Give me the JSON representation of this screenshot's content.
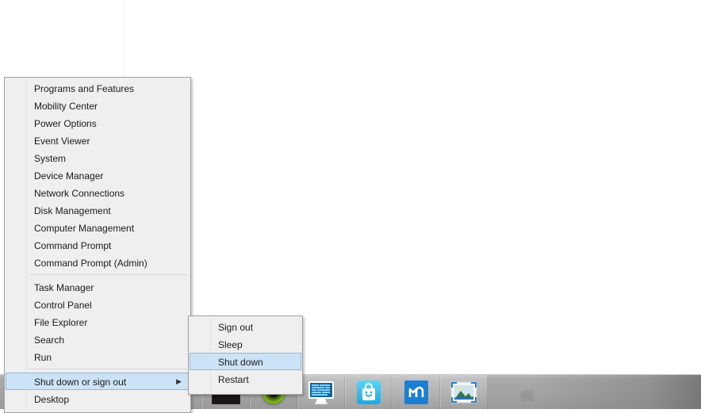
{
  "desktop": {
    "background_color": "#ffffff"
  },
  "winx_menu": {
    "name": "Win+X power user menu",
    "groups": [
      {
        "items": [
          {
            "label": "Programs and Features",
            "name": "programs-and-features"
          },
          {
            "label": "Mobility Center",
            "name": "mobility-center"
          },
          {
            "label": "Power Options",
            "name": "power-options"
          },
          {
            "label": "Event Viewer",
            "name": "event-viewer"
          },
          {
            "label": "System",
            "name": "system"
          },
          {
            "label": "Device Manager",
            "name": "device-manager"
          },
          {
            "label": "Network Connections",
            "name": "network-connections"
          },
          {
            "label": "Disk Management",
            "name": "disk-management"
          },
          {
            "label": "Computer Management",
            "name": "computer-management"
          },
          {
            "label": "Command Prompt",
            "name": "command-prompt"
          },
          {
            "label": "Command Prompt (Admin)",
            "name": "command-prompt-admin"
          }
        ]
      },
      {
        "items": [
          {
            "label": "Task Manager",
            "name": "task-manager"
          },
          {
            "label": "Control Panel",
            "name": "control-panel"
          },
          {
            "label": "File Explorer",
            "name": "file-explorer"
          },
          {
            "label": "Search",
            "name": "search"
          },
          {
            "label": "Run",
            "name": "run"
          }
        ]
      },
      {
        "items": [
          {
            "label": "Shut down or sign out",
            "name": "shut-down-or-sign-out",
            "selected": true,
            "submenu": true,
            "arrow": "▶"
          },
          {
            "label": "Desktop",
            "name": "desktop"
          }
        ]
      }
    ],
    "highlight_color": "#cce3f7",
    "highlight_border_color": "#8cb8dd",
    "background_color": "#efefef",
    "border_color": "#a0a0a0"
  },
  "submenu": {
    "name": "Shut down or sign out submenu",
    "items": [
      {
        "label": "Sign out",
        "name": "sign-out"
      },
      {
        "label": "Sleep",
        "name": "sleep"
      },
      {
        "label": "Shut down",
        "name": "shut-down",
        "selected": true
      },
      {
        "label": "Restart",
        "name": "restart"
      }
    ]
  },
  "taskbar": {
    "background_color": "#a3a3a3",
    "buttons": [
      {
        "name": "taskbar-app-red-tile",
        "icon": "red-app-icon",
        "active": false
      },
      {
        "name": "taskbar-app-media-player",
        "icon": "green-ring-icon",
        "active": false
      },
      {
        "name": "taskbar-app-remote-desktop",
        "icon": "monitor-icon",
        "active": true
      },
      {
        "name": "taskbar-app-store",
        "icon": "store-bag-icon",
        "active": true
      },
      {
        "name": "taskbar-app-maxthon",
        "icon": "maxthon-browser-icon",
        "active": true
      },
      {
        "name": "taskbar-app-photo-viewer",
        "icon": "photo-icon",
        "active": true
      }
    ]
  }
}
